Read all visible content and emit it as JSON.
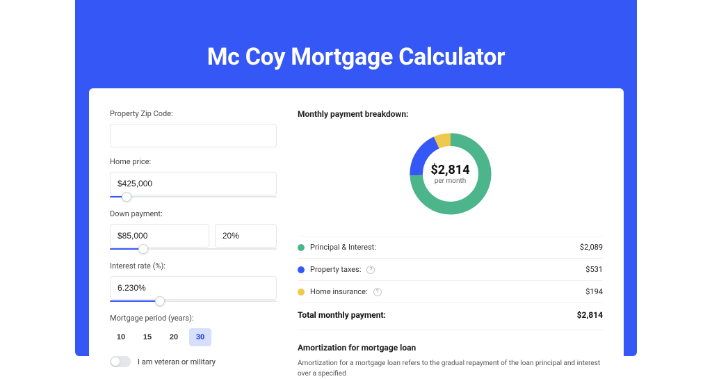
{
  "colors": {
    "accent": "#3457f5",
    "green": "#4cb58c",
    "blue": "#3457f5",
    "yellow": "#efc94c"
  },
  "title": "Mc Coy Mortgage Calculator",
  "form": {
    "zip_label": "Property Zip Code:",
    "zip_value": "",
    "home_price_label": "Home price:",
    "home_price_value": "$425,000",
    "home_price_slider_pct": 10,
    "down_payment_label": "Down payment:",
    "down_payment_amount": "$85,000",
    "down_payment_pct": "20%",
    "down_payment_slider_pct": 20,
    "interest_label": "Interest rate (%):",
    "interest_value": "6.230%",
    "interest_slider_pct": 30,
    "period_label": "Mortgage period (years):",
    "periods": [
      "10",
      "15",
      "20",
      "30"
    ],
    "period_selected": "30",
    "veteran_label": "I am veteran or military",
    "veteran_on": false
  },
  "breakdown": {
    "heading": "Monthly payment breakdown:",
    "center_value": "$2,814",
    "center_sub": "per month",
    "items": [
      {
        "label": "Principal & Interest:",
        "value": "$2,089",
        "color": "#4cb58c",
        "info": false,
        "pct": 74.2
      },
      {
        "label": "Property taxes:",
        "value": "$531",
        "color": "#3457f5",
        "info": true,
        "pct": 18.9
      },
      {
        "label": "Home insurance:",
        "value": "$194",
        "color": "#efc94c",
        "info": true,
        "pct": 6.9
      }
    ],
    "total_label": "Total monthly payment:",
    "total_value": "$2,814"
  },
  "amortization": {
    "heading": "Amortization for mortgage loan",
    "text": "Amortization for a mortgage loan refers to the gradual repayment of the loan principal and interest over a specified"
  },
  "chart_data": {
    "type": "pie",
    "title": "Monthly payment breakdown",
    "series": [
      {
        "name": "Principal & Interest",
        "value": 2089
      },
      {
        "name": "Property taxes",
        "value": 531
      },
      {
        "name": "Home insurance",
        "value": 194
      }
    ],
    "total": 2814,
    "unit": "USD/month"
  }
}
